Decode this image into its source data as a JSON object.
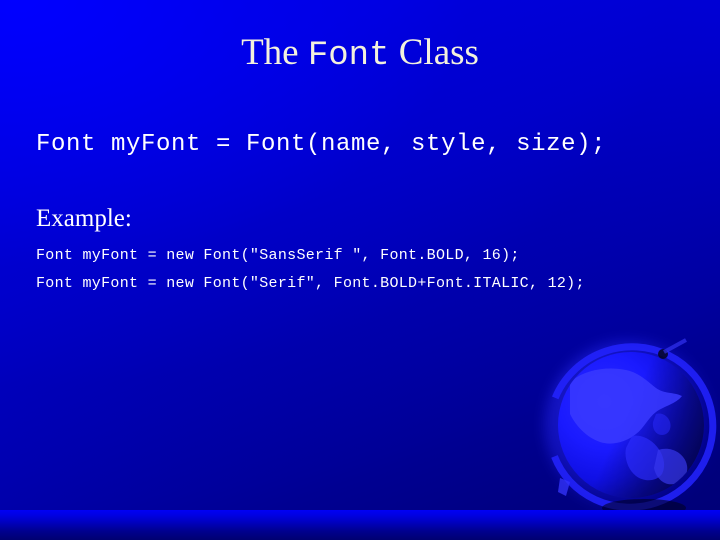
{
  "slide": {
    "title": {
      "part1": "The ",
      "mono": "Font",
      "part2": " Class"
    },
    "signature_line": "Font myFont = Font(name, style, size);",
    "example_label": "Example:",
    "code_lines": [
      "Font myFont = new Font(\"SansSerif \", Font.BOLD, 16);",
      "Font myFont = new Font(\"Serif\", Font.BOLD+Font.ITALIC, 12);"
    ],
    "decoration": {
      "globe": "globe-watermark-icon"
    },
    "colors": {
      "background_bright": "#0000ff",
      "background_dark": "#000074",
      "title_text": "#f3f1dd",
      "body_text": "#ffffff",
      "base_band": "#0000f5"
    }
  }
}
